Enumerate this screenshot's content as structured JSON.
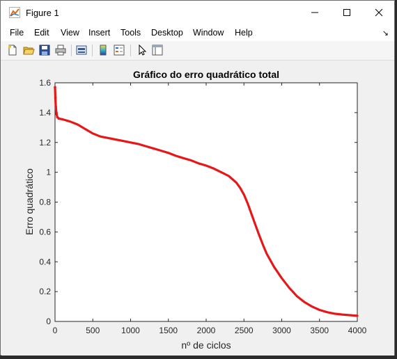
{
  "window": {
    "title": "Figure 1",
    "controls": [
      "minimize-icon",
      "maximize-icon",
      "close-icon"
    ]
  },
  "menu": {
    "items": [
      "File",
      "Edit",
      "View",
      "Insert",
      "Tools",
      "Desktop",
      "Window",
      "Help"
    ],
    "dock_icon": "dock-arrow-icon"
  },
  "toolbar": {
    "buttons": [
      "new-figure-icon",
      "open-file-icon",
      "save-icon",
      "print-icon",
      "print-preview-icon",
      "colorbar-icon",
      "legend-icon",
      "edit-plot-icon",
      "property-editor-icon"
    ]
  },
  "colors": {
    "line": "#e81717",
    "axes_bg": "#ffffff",
    "figure_bg": "#f0f0f0"
  },
  "chart_data": {
    "type": "line",
    "title": "Gráfico do erro quadrático total",
    "xlabel": "nº de ciclos",
    "ylabel": "Erro quadrático",
    "xlim": [
      0,
      4000
    ],
    "ylim": [
      0,
      1.6
    ],
    "xticks": [
      "0",
      "500",
      "1000",
      "1500",
      "2000",
      "2500",
      "3000",
      "3500",
      "4000"
    ],
    "yticks": [
      "0",
      "0.2",
      "0.4",
      "0.6",
      "0.8",
      "1",
      "1.2",
      "1.4",
      "1.6"
    ],
    "grid": false,
    "series": [
      {
        "marker": "point",
        "x": [
          0,
          5,
          10,
          20,
          30,
          50,
          100,
          200,
          300,
          400,
          500,
          600,
          700,
          800,
          900,
          1000,
          1100,
          1200,
          1300,
          1400,
          1500,
          1600,
          1700,
          1800,
          1900,
          2000,
          2100,
          2200,
          2300,
          2400,
          2450,
          2500,
          2550,
          2600,
          2650,
          2700,
          2750,
          2800,
          2900,
          3000,
          3100,
          3200,
          3300,
          3400,
          3500,
          3600,
          3700,
          3800,
          3900,
          4000
        ],
        "y": [
          1.57,
          1.5,
          1.44,
          1.39,
          1.37,
          1.36,
          1.355,
          1.34,
          1.32,
          1.29,
          1.26,
          1.24,
          1.23,
          1.22,
          1.21,
          1.2,
          1.19,
          1.175,
          1.16,
          1.145,
          1.13,
          1.11,
          1.095,
          1.08,
          1.06,
          1.045,
          1.025,
          1.0,
          0.975,
          0.93,
          0.895,
          0.85,
          0.79,
          0.72,
          0.65,
          0.58,
          0.515,
          0.455,
          0.365,
          0.29,
          0.225,
          0.17,
          0.13,
          0.1,
          0.077,
          0.062,
          0.052,
          0.046,
          0.042,
          0.038
        ]
      }
    ]
  }
}
